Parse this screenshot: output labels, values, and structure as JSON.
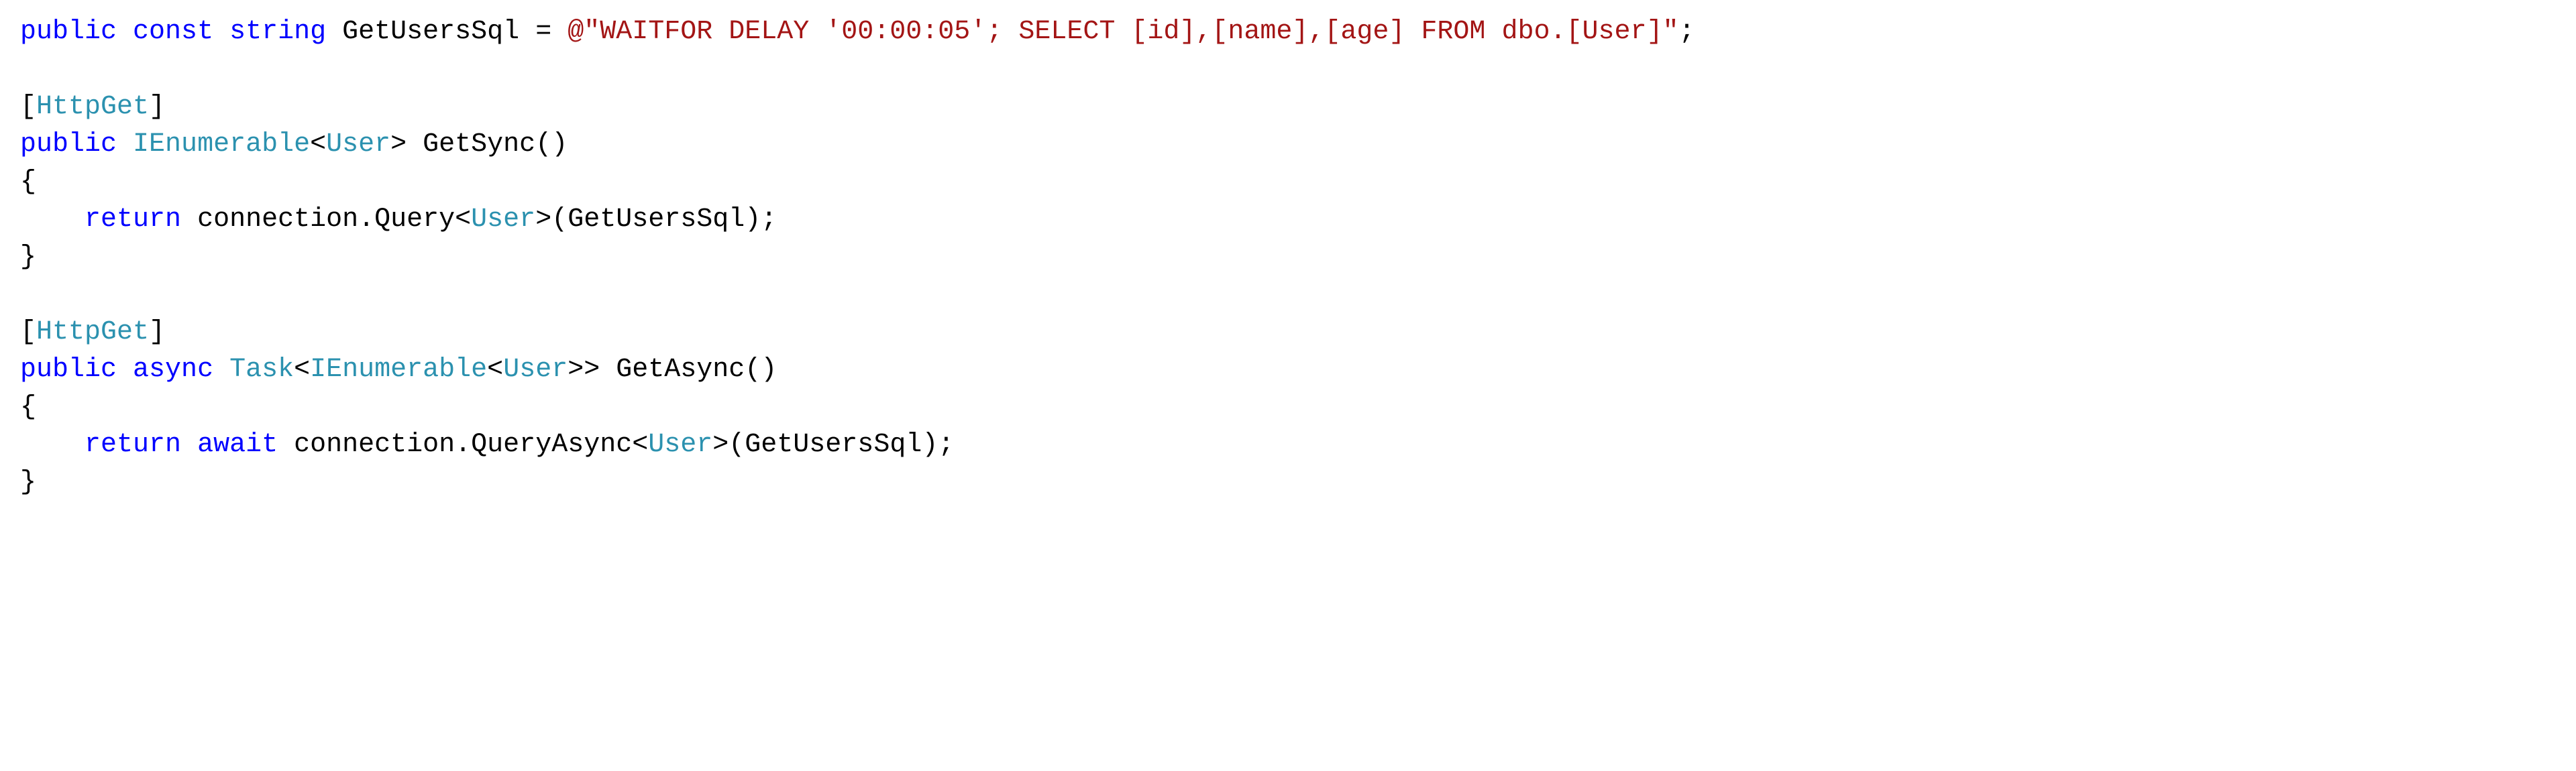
{
  "code": {
    "kw_public": "public",
    "kw_const": "const",
    "kw_string": "string",
    "kw_return": "return",
    "kw_async": "async",
    "kw_await": "await",
    "ident_GetUsersSql": "GetUsersSql",
    "op_eq": " = ",
    "str_prefix": "@\"",
    "str_body": "WAITFOR DELAY '00:00:05'; SELECT [id],[name],[age] FROM dbo.[User]",
    "str_suffix": "\"",
    "semi": ";",
    "attr_open": "[",
    "attr_close": "]",
    "attr_HttpGet": "HttpGet",
    "type_IEnumerable": "IEnumerable",
    "type_User": "User",
    "type_Task": "Task",
    "lt": "<",
    "gt": ">",
    "ident_GetSync": "GetSync",
    "ident_GetAsync": "GetAsync",
    "parens_empty": "()",
    "brace_open": "{",
    "brace_close": "}",
    "indent": "    ",
    "ident_connection": "connection",
    "dot": ".",
    "ident_Query": "Query",
    "ident_QueryAsync": "QueryAsync",
    "paren_open": "(",
    "paren_close": ")"
  }
}
